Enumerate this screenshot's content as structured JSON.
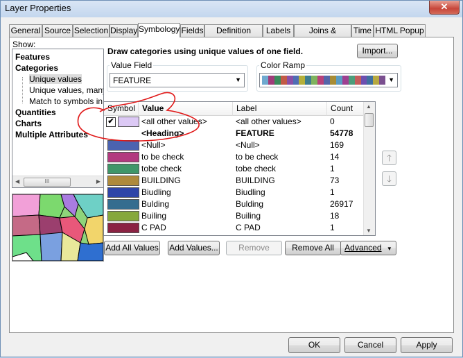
{
  "window": {
    "title": "Layer Properties",
    "close_glyph": "✕"
  },
  "tabs": [
    {
      "label": "General",
      "active": false
    },
    {
      "label": "Source",
      "active": false
    },
    {
      "label": "Selection",
      "active": false
    },
    {
      "label": "Display",
      "active": false
    },
    {
      "label": "Symbology",
      "active": true
    },
    {
      "label": "Fields",
      "active": false
    },
    {
      "label": "Definition Query",
      "active": false
    },
    {
      "label": "Labels",
      "active": false
    },
    {
      "label": "Joins & Relates",
      "active": false
    },
    {
      "label": "Time",
      "active": false
    },
    {
      "label": "HTML Popup",
      "active": false
    }
  ],
  "show": {
    "label": "Show:",
    "items": [
      {
        "label": "Features",
        "style": "bold"
      },
      {
        "label": "Categories",
        "style": "bold"
      },
      {
        "label": "Unique values",
        "style": "child-selected"
      },
      {
        "label": "Unique values, many",
        "style": "child"
      },
      {
        "label": "Match to symbols in a",
        "style": "child"
      },
      {
        "label": "Quantities",
        "style": "bold"
      },
      {
        "label": "Charts",
        "style": "bold"
      },
      {
        "label": "Multiple Attributes",
        "style": "bold"
      }
    ],
    "scroll_grip": "III"
  },
  "header": {
    "description": "Draw categories using unique values of one field.",
    "import_label": "Import..."
  },
  "value_field": {
    "label": "Value Field",
    "value": "FEATURE"
  },
  "color_ramp": {
    "label": "Color Ramp",
    "colors": [
      "#6fa9cf",
      "#a03c7a",
      "#3a8b5b",
      "#c25b46",
      "#8a4fa6",
      "#4f6db4",
      "#b5b03a",
      "#3e7d8f",
      "#7fb35e",
      "#b8417a",
      "#5465a9",
      "#a88c35",
      "#5a9bc2",
      "#9e3f91",
      "#4c9d7b",
      "#c45c5c",
      "#6d4fb0",
      "#3f6fa0",
      "#b7a940",
      "#7a4f8f"
    ]
  },
  "table": {
    "headers": {
      "symbol": "Symbol",
      "value": "Value",
      "label": "Label",
      "count": "Count"
    },
    "rows": [
      {
        "checked": true,
        "color": "#dcc9f5",
        "value": "<all other values>",
        "label": "<all other values>",
        "count": "0",
        "bold": false
      },
      {
        "checked": false,
        "color": "",
        "value": "<Heading>",
        "label": "FEATURE",
        "count": "54778",
        "bold": true
      },
      {
        "checked": false,
        "color": "#4b63b0",
        "value": "<Null>",
        "label": "<Null>",
        "count": "169",
        "bold": false
      },
      {
        "checked": false,
        "color": "#b2397f",
        "value": "to be check",
        "label": "to be check",
        "count": "14",
        "bold": false
      },
      {
        "checked": false,
        "color": "#3f9669",
        "value": "tobe check",
        "label": "tobe check",
        "count": "1",
        "bold": false
      },
      {
        "checked": false,
        "color": "#ae8a3c",
        "value": "BUILDING",
        "label": "BUILDING",
        "count": "73",
        "bold": false
      },
      {
        "checked": false,
        "color": "#2f45a8",
        "value": "Biudling",
        "label": "Biudling",
        "count": "1",
        "bold": false
      },
      {
        "checked": false,
        "color": "#356d8f",
        "value": "Bulding",
        "label": "Bulding",
        "count": "26917",
        "bold": false
      },
      {
        "checked": false,
        "color": "#86a83c",
        "value": "Builing",
        "label": "Builing",
        "count": "18",
        "bold": false
      },
      {
        "checked": false,
        "color": "#8a2243",
        "value": "C PAD",
        "label": "C PAD",
        "count": "1",
        "bold": false
      }
    ]
  },
  "side_buttons": {
    "up_glyph": "🡑",
    "down_glyph": "🡓"
  },
  "buttons": {
    "add_all": "Add All Values",
    "add_values": "Add Values...",
    "remove": "Remove",
    "remove_all": "Remove All",
    "advanced": "Advanced"
  },
  "footer": {
    "ok": "OK",
    "cancel": "Cancel",
    "apply": "Apply"
  },
  "colors": {
    "annotation": "#e01818",
    "selected": "#dcdcdc"
  }
}
